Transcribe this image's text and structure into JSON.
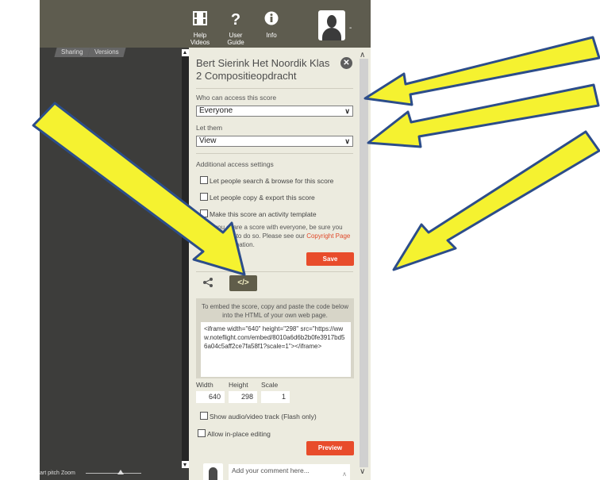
{
  "toolbar": {
    "help_videos": "Help Videos",
    "user_guide": "User Guide",
    "info": "Info",
    "avatar_caret": "-"
  },
  "score_tabs": [
    "Sharing",
    "Versions"
  ],
  "bottom_bar": {
    "pitch_label": "art pitch",
    "zoom_label": "Zoom"
  },
  "panel": {
    "title": "Bert Sierink Het Noordik Klas 2 Compositieopdracht",
    "close": "✕",
    "access_label": "Who can access this score",
    "access_value": "Everyone",
    "let_them_label": "Let them",
    "let_them_value": "View",
    "additional_label": "Additional access settings",
    "checkboxes": [
      "Let people search & browse for this score",
      "Let people copy & export this score",
      "Make this score an activity template"
    ],
    "note_before": "When you share a score with everyone, be sure you have the right to do so. Please see our ",
    "note_link": "Copyright Page",
    "note_after": " for more information.",
    "save_label": "Save",
    "embed_tab_label": "</>",
    "embed_instructions": "To embed the score, copy and paste the code below into the HTML of your own web page.",
    "embed_code": "<iframe width=\"640\" height=\"298\" src=\"https://www.noteflight.com/embed/8010a6d6b2b0fe3917bd56a04c5aff2ce7fa58f1?scale=1\"></iframe>",
    "width_label": "Width",
    "height_label": "Height",
    "scale_label": "Scale",
    "width_value": "640",
    "height_value": "298",
    "scale_value": "1",
    "show_av_label": "Show audio/video track (Flash only)",
    "allow_edit_label": "Allow in-place editing",
    "preview_label": "Preview",
    "comment_placeholder": "Add your comment here..."
  },
  "colors": {
    "accent": "#e84c2b",
    "toolbar": "#5e5c4f",
    "panel": "#ecebdf",
    "arrow_fill": "#f5f230",
    "arrow_stroke": "#2c4d8a"
  },
  "annotation_arrows": 5
}
